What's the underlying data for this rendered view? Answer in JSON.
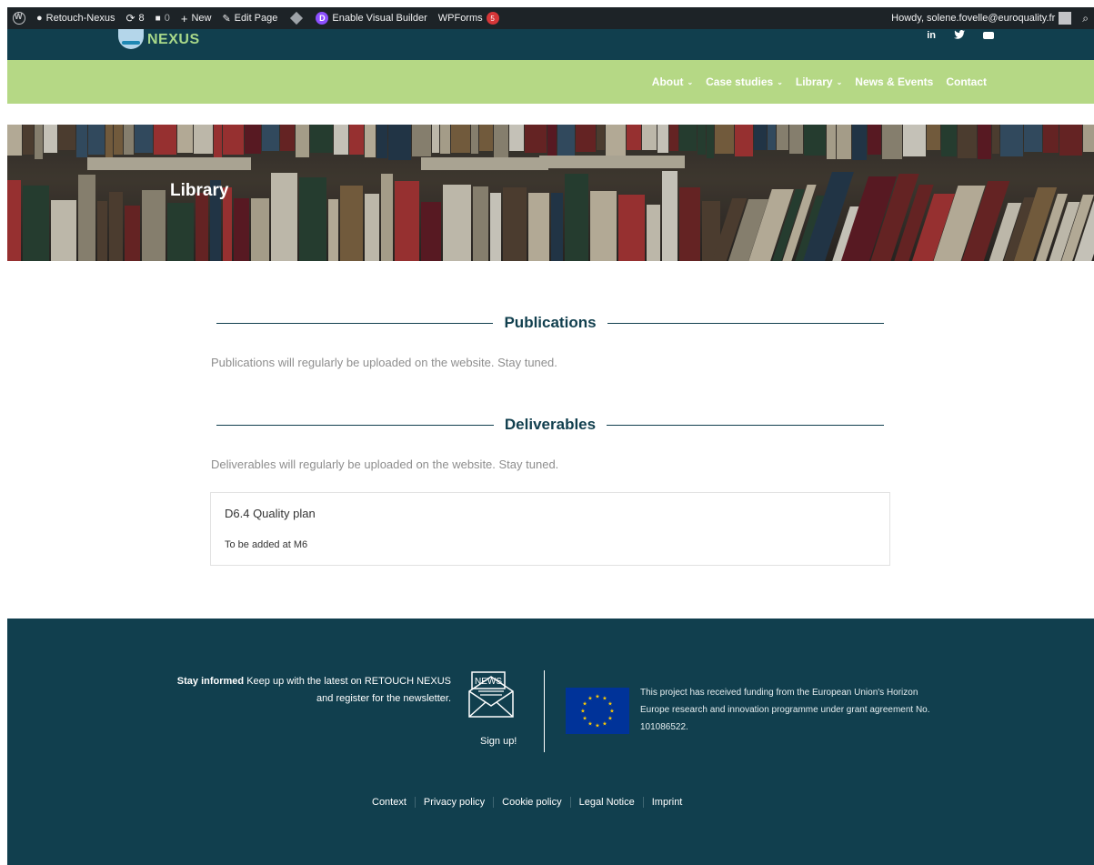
{
  "admin_bar": {
    "site_name": "Retouch-Nexus",
    "updates_count": "8",
    "comments_count": "0",
    "new_label": "New",
    "edit_page_label": "Edit Page",
    "visual_builder_label": "Enable Visual Builder",
    "wpforms_label": "WPForms",
    "wpforms_count": "5",
    "howdy_text": "Howdy, solene.fovelle@euroquality.fr"
  },
  "header": {
    "logo_text": "NEXUS",
    "social": {
      "linkedin": "in"
    }
  },
  "nav": {
    "items": [
      {
        "label": "About",
        "has_dropdown": true
      },
      {
        "label": "Case studies",
        "has_dropdown": true
      },
      {
        "label": "Library",
        "has_dropdown": true
      },
      {
        "label": "News & Events",
        "has_dropdown": false
      },
      {
        "label": "Contact",
        "has_dropdown": false
      }
    ]
  },
  "hero": {
    "title": "Library"
  },
  "sections": {
    "publications": {
      "title": "Publications",
      "text": "Publications will regularly be uploaded on the website. Stay tuned."
    },
    "deliverables": {
      "title": "Deliverables",
      "text": "Deliverables will regularly be uploaded on the website. Stay tuned.",
      "items": [
        {
          "title": "D6.4 Quality plan",
          "body": "To be added at M6"
        }
      ]
    }
  },
  "footer": {
    "stay_bold": "Stay informed",
    "stay_text": " Keep up with the latest on RETOUCH NEXUS and register for the newsletter.",
    "news_icon_label": "NEWS",
    "signup_label": "Sign up!",
    "funding_text": "This project has received funding from the European Union's Horizon Europe research and innovation programme under grant agreement No. 101086522.",
    "links": [
      "Context",
      "Privacy policy",
      "Cookie policy",
      "Legal Notice",
      "Imprint"
    ]
  },
  "colors": {
    "admin_bar": "#1d2327",
    "header_dark": "#113f4e",
    "nav_green": "#b5d885",
    "eu_blue": "#003399",
    "eu_star": "#ffcc00",
    "badge_red": "#d63638",
    "divi_purple": "#8c4fff"
  }
}
